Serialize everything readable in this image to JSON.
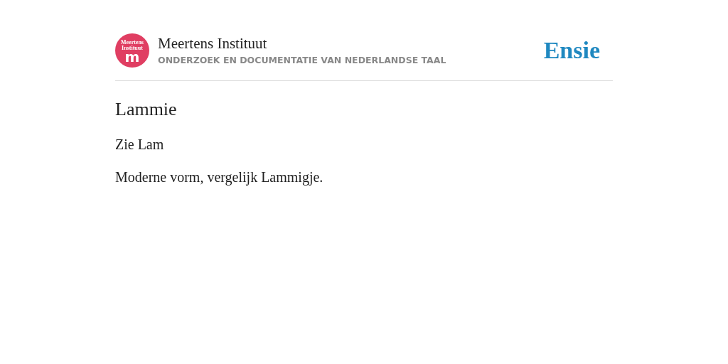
{
  "header": {
    "logo": {
      "line_1": "Meertens",
      "line_2": "Instituut",
      "letter": "m"
    },
    "title": "Meertens Instituut",
    "subtitle": "ONDERZOEK EN DOCUMENTATIE VAN NEDERLANDSE TAAL",
    "brand": "Ensie"
  },
  "entry": {
    "title": "Lammie",
    "paragraphs": [
      "Zie Lam",
      "Moderne vorm, vergelijk Lammigje."
    ]
  }
}
